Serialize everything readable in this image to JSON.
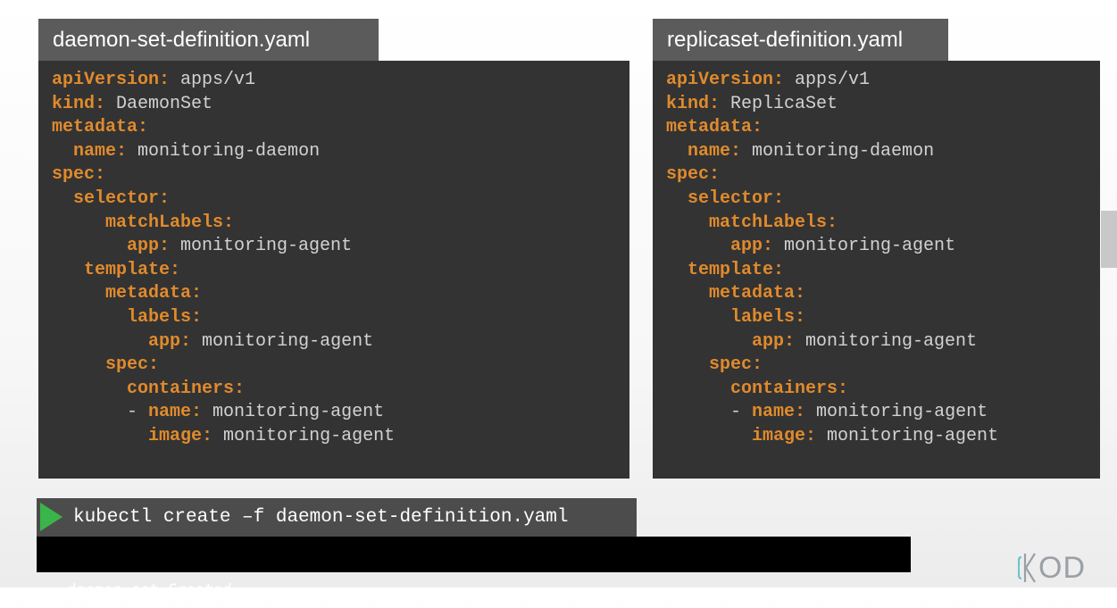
{
  "panels": [
    {
      "tab_label": "daemon-set-definition.yaml",
      "lines": [
        {
          "indent": "",
          "key": "apiVersion:",
          "value": " apps/v1"
        },
        {
          "indent": "",
          "key": "kind:",
          "value": " DaemonSet"
        },
        {
          "indent": "",
          "key": "metadata:",
          "value": ""
        },
        {
          "indent": "  ",
          "key": "name:",
          "value": " monitoring-daemon"
        },
        {
          "indent": "",
          "key": "spec:",
          "value": ""
        },
        {
          "indent": "  ",
          "key": "selector:",
          "value": ""
        },
        {
          "indent": "     ",
          "key": "matchLabels:",
          "value": ""
        },
        {
          "indent": "       ",
          "key": "app:",
          "value": " monitoring-agent"
        },
        {
          "indent": "   ",
          "key": "template:",
          "value": ""
        },
        {
          "indent": "     ",
          "key": "metadata:",
          "value": ""
        },
        {
          "indent": "       ",
          "key": "labels:",
          "value": ""
        },
        {
          "indent": "         ",
          "key": "app:",
          "value": " monitoring-agent"
        },
        {
          "indent": "     ",
          "key": "spec:",
          "value": ""
        },
        {
          "indent": "       ",
          "key": "containers:",
          "value": ""
        },
        {
          "indent": "       ",
          "prefix": "- ",
          "key": "name:",
          "value": " monitoring-agent"
        },
        {
          "indent": "         ",
          "key": "image:",
          "value": " monitoring-agent"
        }
      ]
    },
    {
      "tab_label": "replicaset-definition.yaml",
      "lines": [
        {
          "indent": "",
          "key": "apiVersion:",
          "value": " apps/v1"
        },
        {
          "indent": "",
          "key": "kind:",
          "value": " ReplicaSet"
        },
        {
          "indent": "",
          "key": "metadata:",
          "value": ""
        },
        {
          "indent": "  ",
          "key": "name:",
          "value": " monitoring-daemon"
        },
        {
          "indent": "",
          "key": "spec:",
          "value": ""
        },
        {
          "indent": "  ",
          "key": "selector:",
          "value": ""
        },
        {
          "indent": "    ",
          "key": "matchLabels:",
          "value": ""
        },
        {
          "indent": "      ",
          "key": "app:",
          "value": " monitoring-agent"
        },
        {
          "indent": "  ",
          "key": "template:",
          "value": ""
        },
        {
          "indent": "    ",
          "key": "metadata:",
          "value": ""
        },
        {
          "indent": "      ",
          "key": "labels:",
          "value": ""
        },
        {
          "indent": "        ",
          "key": "app:",
          "value": " monitoring-agent"
        },
        {
          "indent": "    ",
          "key": "spec:",
          "value": ""
        },
        {
          "indent": "      ",
          "key": "containers:",
          "value": ""
        },
        {
          "indent": "      ",
          "prefix": "- ",
          "key": "name:",
          "value": " monitoring-agent"
        },
        {
          "indent": "        ",
          "key": "image:",
          "value": " monitoring-agent"
        }
      ]
    }
  ],
  "terminal": {
    "command": "kubectl create –f daemon-set-definition.yaml",
    "output": "daemon-set Created",
    "run_icon": "play-icon"
  },
  "branding": {
    "logo_text": "OD",
    "logo_icon": "kodekloud-logo-icon"
  },
  "colors": {
    "key": "#e08a2c",
    "value": "#d2d2d2",
    "panel_bg": "#333333",
    "tab_bg": "#5b5b5b",
    "play": "#3ab54a"
  }
}
